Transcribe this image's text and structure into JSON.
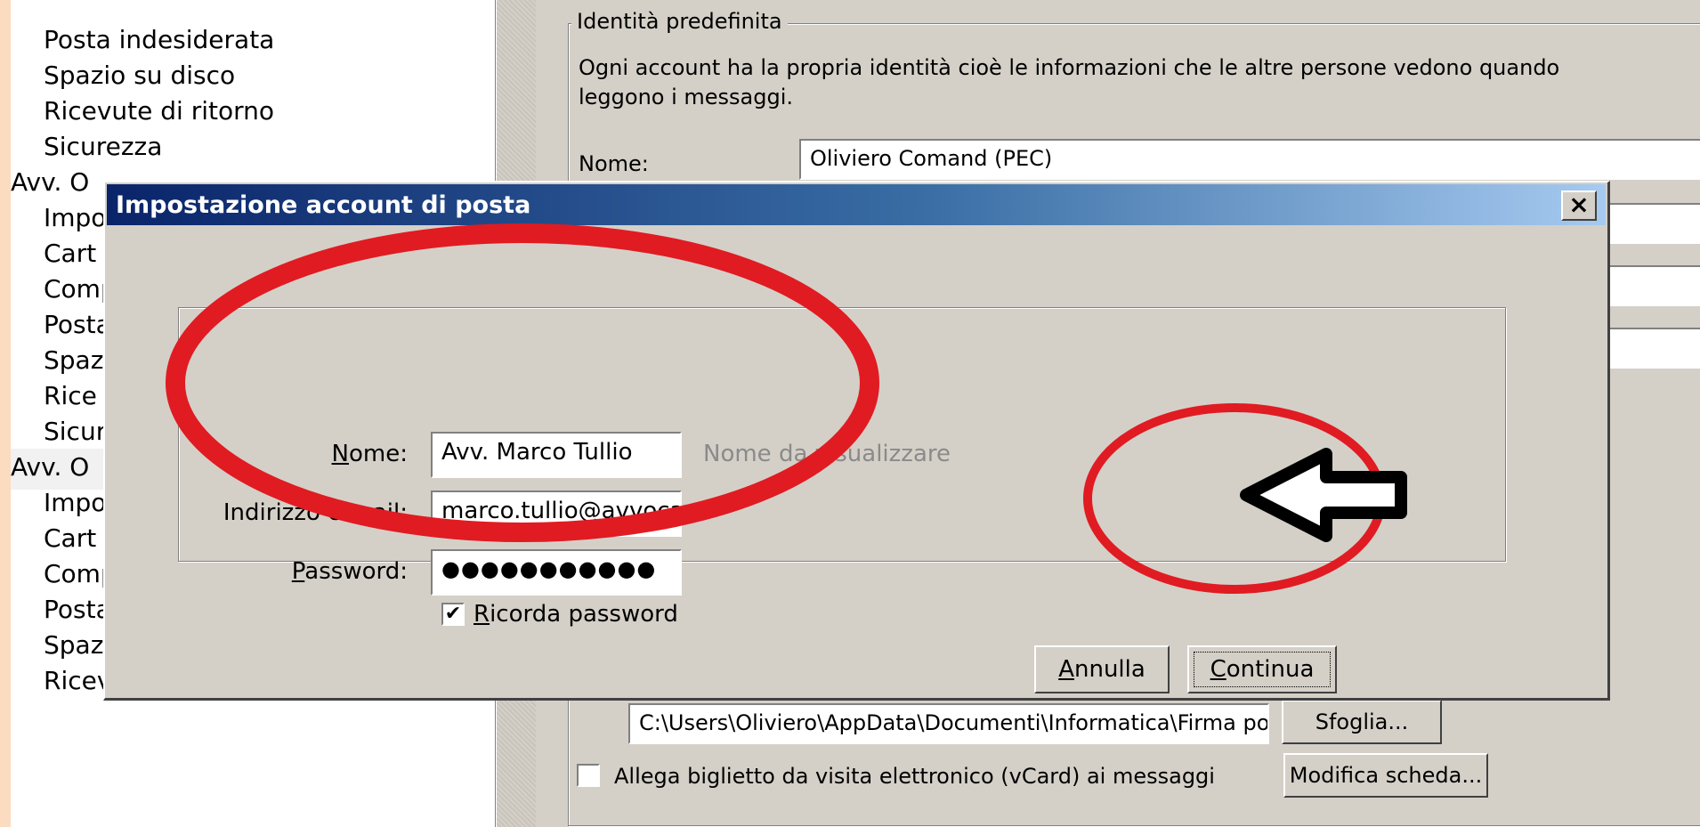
{
  "tree": {
    "items": [
      "Posta indesiderata",
      "Spazio su disco",
      "Ricevute di ritorno",
      "Sicurezza",
      "Avv. O",
      "Impo",
      "Cart",
      "Comp",
      "Posta",
      "Spaz",
      "Rice",
      "Sicur",
      "Avv. O",
      "Impo",
      "Cart",
      "Comp",
      "Posta indesiderata",
      "Spazio su disco",
      "Ricevute di ritorno"
    ]
  },
  "panel": {
    "group_title": "Identità predefinita",
    "description": "Ogni account ha la propria identità cioè le informazioni che le altre persone vedono quando leggono i messaggi.",
    "name_label": "Nome:",
    "name_value": "Oliviero Comand (PEC)",
    "signature_path": "C:\\Users\\Oliviero\\AppData\\Documenti\\Informatica\\Firma posta.html",
    "browse_label": "Sfoglia...",
    "vcard_label": "Allega biglietto da visita elettronico (vCard) ai messaggi",
    "edit_card_label": "Modifica scheda..."
  },
  "dialog": {
    "title": "Impostazione account di posta",
    "close_glyph": "×",
    "name_label": "Nome:",
    "name_value": "Avv. Marco Tullio",
    "name_hint": "Nome da visualizzare",
    "email_label": "Indirizzo e-mail:",
    "email_value": "marco.tullio@avvocatiud",
    "password_label": "Password:",
    "password_value": "●●●●●●●●●●●",
    "remember_label": "Ricorda password",
    "remember_checked": true,
    "checkmark": "✔",
    "cancel_label": "Annulla",
    "continue_label": "Continua"
  },
  "annotations": {
    "circle_color": "#e11b22",
    "arrow_color": "#000000"
  }
}
